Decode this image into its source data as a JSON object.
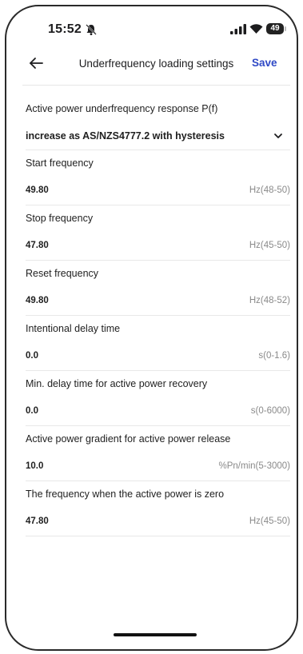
{
  "status_bar": {
    "time": "15:52",
    "battery": "49",
    "icons": [
      "bell-muted-icon",
      "signal-icon",
      "wifi-icon",
      "battery-icon"
    ]
  },
  "header": {
    "back_icon": "back-arrow-icon",
    "title": "Underfrequency loading settings",
    "save_label": "Save"
  },
  "colors": {
    "accent": "#2f49c6",
    "unit_text": "#8a8a8a",
    "divider": "#e8e8e8"
  },
  "response_mode": {
    "label": "Active power underfrequency response P(f)",
    "selected": "increase as AS/NZS4777.2 with hysteresis"
  },
  "fields": [
    {
      "label": "Start frequency",
      "value": "49.80",
      "unit": "Hz(48-50)"
    },
    {
      "label": "Stop frequency",
      "value": "47.80",
      "unit": "Hz(45-50)"
    },
    {
      "label": "Reset frequency",
      "value": "49.80",
      "unit": "Hz(48-52)"
    },
    {
      "label": "Intentional delay time",
      "value": "0.0",
      "unit": "s(0-1.6)"
    },
    {
      "label": "Min. delay time for active power recovery",
      "value": "0.0",
      "unit": "s(0-6000)"
    },
    {
      "label": "Active power gradient for active power release",
      "value": "10.0",
      "unit": "%Pn/min(5-3000)"
    },
    {
      "label": "The frequency when the active power is zero",
      "value": "47.80",
      "unit": "Hz(45-50)"
    }
  ]
}
